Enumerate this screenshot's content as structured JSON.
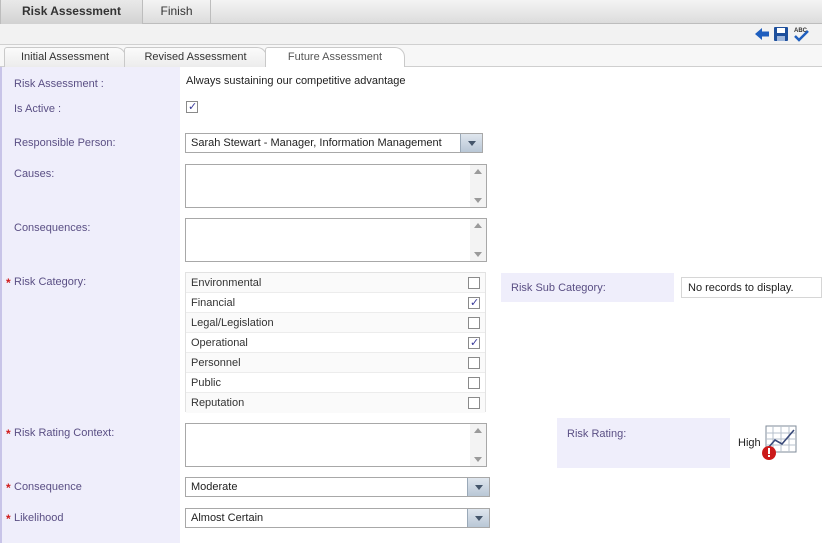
{
  "top_tabs": [
    {
      "label": "Risk Assessment",
      "active": true
    },
    {
      "label": "Finish",
      "active": false
    }
  ],
  "toolbar": {
    "icons": [
      "back-arrow-icon",
      "save-icon",
      "spell-check-icon"
    ],
    "spell_label": "ABC"
  },
  "sub_tabs": [
    {
      "label": "Initial Assessment",
      "active": false
    },
    {
      "label": "Revised Assessment",
      "active": false
    },
    {
      "label": "Future Assessment",
      "active": true
    }
  ],
  "form": {
    "risk_assessment": {
      "label": "Risk Assessment :",
      "value": "Always sustaining our competitive advantage"
    },
    "is_active": {
      "label": "Is Active :",
      "checked": true
    },
    "responsible_person": {
      "label": "Responsible Person:",
      "value": "Sarah Stewart - Manager, Information Management"
    },
    "causes": {
      "label": "Causes:",
      "value": ""
    },
    "consequences": {
      "label": "Consequences:",
      "value": ""
    },
    "risk_category": {
      "label": "Risk Category:",
      "required": true,
      "items": [
        {
          "label": "Environmental",
          "checked": false
        },
        {
          "label": "Financial",
          "checked": true
        },
        {
          "label": "Legal/Legislation",
          "checked": false
        },
        {
          "label": "Operational",
          "checked": true
        },
        {
          "label": "Personnel",
          "checked": false
        },
        {
          "label": "Public",
          "checked": false
        },
        {
          "label": "Reputation",
          "checked": false
        }
      ]
    },
    "risk_sub_category": {
      "label": "Risk Sub Category:",
      "value": "No records to display."
    },
    "risk_rating_context": {
      "label": "Risk Rating Context:",
      "required": true,
      "value": ""
    },
    "risk_rating": {
      "label": "Risk Rating:",
      "value": "High",
      "icon": "risk-matrix-warning-icon"
    },
    "consequence": {
      "label": "Consequence",
      "required": true,
      "value": "Moderate"
    },
    "likelihood": {
      "label": "Likelihood",
      "required": true,
      "value": "Almost Certain"
    },
    "required_marker": "*"
  },
  "colors": {
    "label_text": "#5a4f84",
    "panel_bg": "#efeefb",
    "required": "#d01c1c",
    "icon_blue": "#1f5fbf"
  }
}
